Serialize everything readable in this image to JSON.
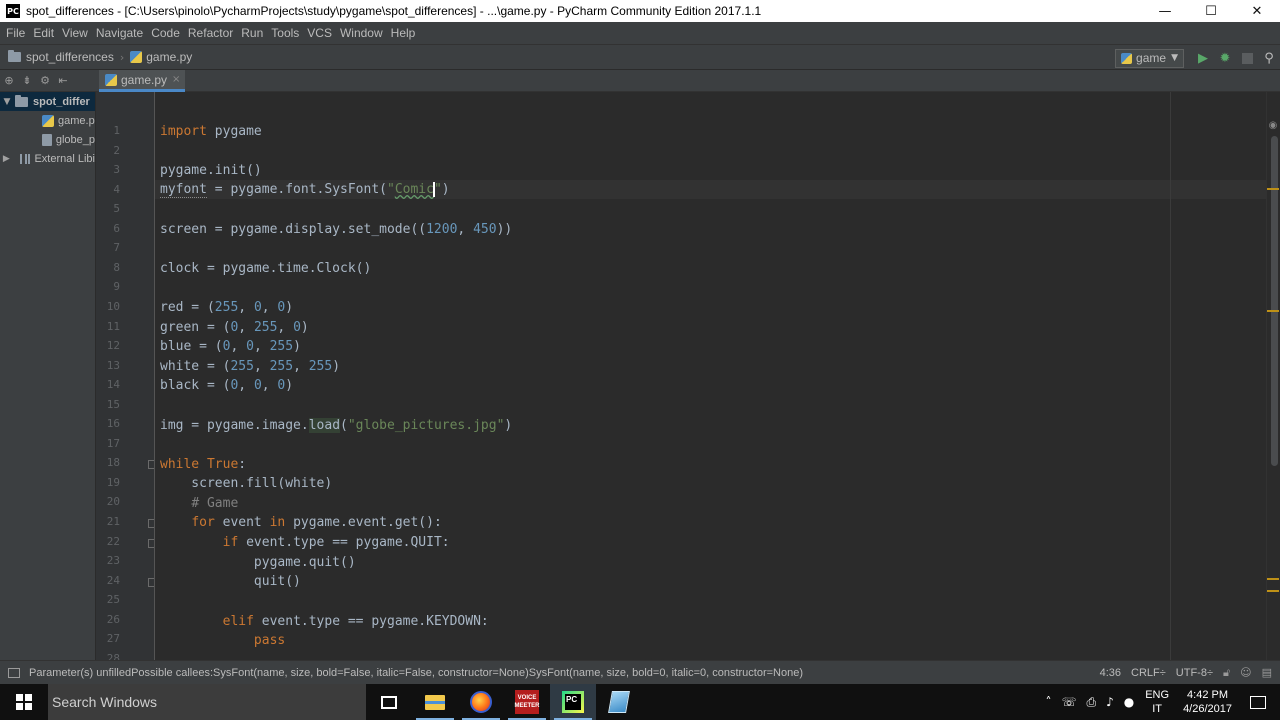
{
  "window": {
    "title": "spot_differences - [C:\\Users\\pinolo\\PycharmProjects\\study\\pygame\\spot_differences] - ...\\game.py - PyCharm Community Edition 2017.1.1",
    "app_icon_text": "PC",
    "minimize": "—",
    "maximize": "☐",
    "close": "✕"
  },
  "menu": [
    "File",
    "Edit",
    "View",
    "Navigate",
    "Code",
    "Refactor",
    "Run",
    "Tools",
    "VCS",
    "Window",
    "Help"
  ],
  "breadcrumbs": {
    "project": "spot_differences",
    "file": "game.py"
  },
  "run_config": {
    "label": "game"
  },
  "project_tree": {
    "root": "spot_differ",
    "items": [
      "game.p",
      "globe_p"
    ],
    "external": "External Libi"
  },
  "editor_tab": {
    "label": "game.py",
    "close": "×"
  },
  "editor": {
    "line_numbers": [
      "1",
      "2",
      "3",
      "4",
      "5",
      "6",
      "7",
      "8",
      "9",
      "10",
      "11",
      "12",
      "13",
      "14",
      "15",
      "16",
      "17",
      "18",
      "19",
      "20",
      "21",
      "22",
      "23",
      "24",
      "25",
      "26",
      "27",
      "28"
    ]
  },
  "status": {
    "message": "Parameter(s) unfilledPossible callees:SysFont(name, size, bold=False, italic=False, constructor=None)SysFont(name, size, bold=0, italic=0, constructor=None)",
    "position": "4:36",
    "line_sep": "CRLF÷",
    "encoding": "UTF-8÷"
  },
  "taskbar": {
    "search_placeholder": "Search Windows",
    "voicemeeter_line1": "VOICE",
    "voicemeeter_line2": "MEETER",
    "pycharm_text": "PC",
    "lang_top": "ENG",
    "lang_bottom": "IT",
    "time": "4:42 PM",
    "date": "4/26/2017"
  },
  "colors": {
    "keyword": "#cc7832",
    "number": "#6897bb",
    "string": "#6a8759",
    "comment": "#808080",
    "text": "#a9b7c6",
    "background": "#2b2b2b"
  }
}
